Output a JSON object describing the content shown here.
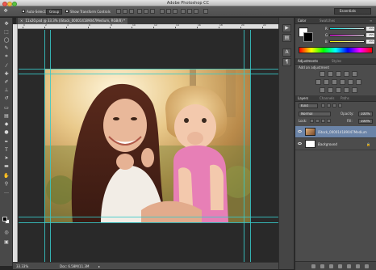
{
  "window": {
    "title": "Adobe Photoshop CC"
  },
  "options_bar": {
    "auto_select_label": "Auto-Select:",
    "auto_select_value": "Group",
    "transform_label": "Show Transform Controls",
    "workspace": "Essentials"
  },
  "document": {
    "tab_label": "11x20.psd @ 33.3% (iStock_000014189047Medium, RGB/8) *",
    "layer_title": "iStock_000014189047Medium"
  },
  "ruler": {
    "ticks": [
      "0",
      "2",
      "4",
      "6",
      "8",
      "10",
      "12",
      "14",
      "16",
      "18",
      "20",
      "22"
    ]
  },
  "status": {
    "zoom": "33.33%",
    "doc_info": "Doc: 6.58M/11.3M"
  },
  "color_panel": {
    "tab_color": "Color",
    "tab_swatches": "Swatches",
    "r_label": "R",
    "g_label": "G",
    "b_label": "B",
    "r_value": "255",
    "g_value": "255",
    "b_value": "255"
  },
  "adjustments_panel": {
    "tab_adjustments": "Adjustments",
    "tab_styles": "Styles",
    "heading": "Add an adjustment"
  },
  "layers_panel": {
    "tab_layers": "Layers",
    "tab_channels": "Channels",
    "tab_paths": "Paths",
    "kind_filter": "Kind",
    "blend_mode": "Normal",
    "opacity_label": "Opacity:",
    "opacity_value": "100%",
    "lock_label": "Lock:",
    "fill_label": "Fill:",
    "fill_value": "100%",
    "layers": [
      {
        "name": "iStock_000014189047Medium",
        "selected": true
      },
      {
        "name": "Background",
        "selected": false
      }
    ]
  },
  "colors": {
    "guide": "#37c9c9",
    "selection": "#6b84a8"
  }
}
